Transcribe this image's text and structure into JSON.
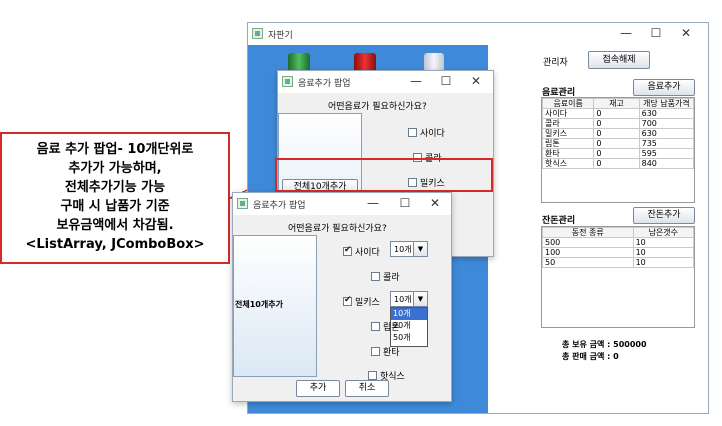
{
  "annotation": {
    "lines": [
      "음료 추가 팝업- 10개단위로",
      "추가가 가능하며,",
      "전체추가기능 가능",
      "구매 시 납품가 기준",
      "보유금액에서 차감됨.",
      "<ListArray, JComboBox>"
    ],
    "box_color": "#d42a2a"
  },
  "main_window": {
    "title": "자판기",
    "controls": [
      "—",
      "☐",
      "✕"
    ],
    "admin_label": "관리자",
    "admin_button": "접속해제",
    "drink_section": "음료관리",
    "add_drink_button": "음료추가",
    "drink_headers": [
      "음료이름",
      "재고",
      "개당 납품가격"
    ],
    "drinks": [
      [
        "사이다",
        "0",
        "630"
      ],
      [
        "콜라",
        "0",
        "700"
      ],
      [
        "밀키스",
        "0",
        "630"
      ],
      [
        "립톤",
        "0",
        "735"
      ],
      [
        "환타",
        "0",
        "595"
      ],
      [
        "핫식스",
        "0",
        "840"
      ]
    ],
    "change_section": "잔돈관리",
    "add_change_button": "잔돈추가",
    "change_headers": [
      "동전 종류",
      "남은갯수"
    ],
    "changes": [
      [
        "500",
        "10"
      ],
      [
        "100",
        "10"
      ],
      [
        "50",
        "10"
      ]
    ],
    "total_held": "총 보유 금액 : 500000",
    "total_sales": "총 판매 금액 : 0",
    "panel_color": "#3f8ad8"
  },
  "popup_back": {
    "title": "음료추가 팝업",
    "controls": [
      "—",
      "☐",
      "✕"
    ],
    "question": "어떤음료가 필요하신가요?",
    "add_all": "전체10개추가",
    "items": [
      {
        "label": "사이다",
        "checked": false
      },
      {
        "label": "콜라",
        "checked": false
      },
      {
        "label": "밀키스",
        "checked": false
      }
    ]
  },
  "popup_front": {
    "title": "음료추가 팝업",
    "controls": [
      "—",
      "☐",
      "✕"
    ],
    "question": "어떤음료가 필요하신가요?",
    "add_all": "전체10개추가",
    "items": [
      {
        "label": "사이다",
        "checked": true,
        "combo": "10개"
      },
      {
        "label": "콜라",
        "checked": false
      },
      {
        "label": "밀키스",
        "checked": true,
        "combo": "10개"
      },
      {
        "label": "립톤",
        "checked": false
      },
      {
        "label": "환타",
        "checked": false
      },
      {
        "label": "핫식스",
        "checked": false
      }
    ],
    "dropdown_options": [
      "10개",
      "20개",
      "50개"
    ],
    "add_button": "추가",
    "cancel_button": "취소"
  }
}
